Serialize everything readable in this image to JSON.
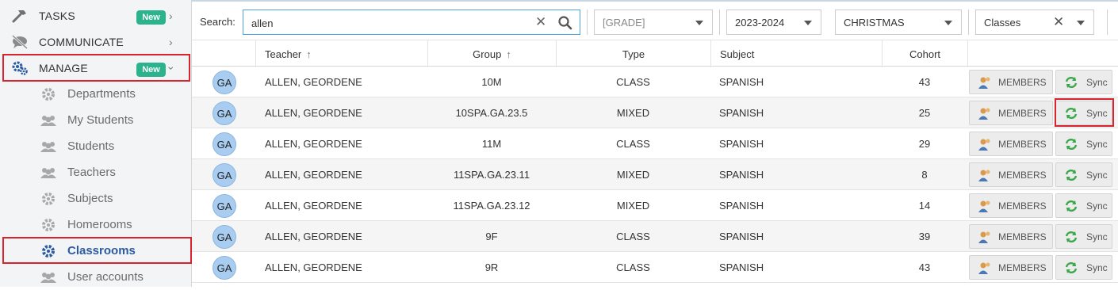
{
  "sidebar": {
    "top_items": [
      {
        "label": "TASKS",
        "badge": "New",
        "icon": "hammer-icon"
      },
      {
        "label": "COMMUNICATE",
        "icon": "chat-icon"
      },
      {
        "label": "MANAGE",
        "badge": "New",
        "icon": "gears-icon"
      }
    ],
    "sub_items": [
      {
        "label": "Departments",
        "icon": "gear-icon"
      },
      {
        "label": "My Students",
        "icon": "users-icon"
      },
      {
        "label": "Students",
        "icon": "users-icon"
      },
      {
        "label": "Teachers",
        "icon": "users-icon"
      },
      {
        "label": "Subjects",
        "icon": "gear-icon"
      },
      {
        "label": "Homerooms",
        "icon": "gear-icon"
      },
      {
        "label": "Classrooms",
        "icon": "gear-icon",
        "active": true
      },
      {
        "label": "User accounts",
        "icon": "users-icon"
      }
    ]
  },
  "filters": {
    "search_label": "Search:",
    "search_value": "allen",
    "grade": "[GRADE]",
    "year": "2023-2024",
    "term": "CHRISTMAS",
    "type": "Classes"
  },
  "table": {
    "headers": {
      "teacher": "Teacher",
      "group": "Group",
      "type": "Type",
      "subject": "Subject",
      "cohort": "Cohort"
    },
    "members_label": "MEMBERS",
    "sync_label": "Sync",
    "rows": [
      {
        "initials": "GA",
        "teacher": "ALLEN, GEORDENE",
        "group": "10M",
        "type": "CLASS",
        "subject": "SPANISH",
        "cohort": "43"
      },
      {
        "initials": "GA",
        "teacher": "ALLEN, GEORDENE",
        "group": "10SPA.GA.23.5",
        "type": "MIXED",
        "subject": "SPANISH",
        "cohort": "25"
      },
      {
        "initials": "GA",
        "teacher": "ALLEN, GEORDENE",
        "group": "11M",
        "type": "CLASS",
        "subject": "SPANISH",
        "cohort": "29"
      },
      {
        "initials": "GA",
        "teacher": "ALLEN, GEORDENE",
        "group": "11SPA.GA.23.11",
        "type": "MIXED",
        "subject": "SPANISH",
        "cohort": "8"
      },
      {
        "initials": "GA",
        "teacher": "ALLEN, GEORDENE",
        "group": "11SPA.GA.23.12",
        "type": "MIXED",
        "subject": "SPANISH",
        "cohort": "14"
      },
      {
        "initials": "GA",
        "teacher": "ALLEN, GEORDENE",
        "group": "9F",
        "type": "CLASS",
        "subject": "SPANISH",
        "cohort": "39"
      },
      {
        "initials": "GA",
        "teacher": "ALLEN, GEORDENE",
        "group": "9R",
        "type": "CLASS",
        "subject": "SPANISH",
        "cohort": "43"
      }
    ]
  },
  "colors": {
    "accent": "#2c5aa0",
    "badge": "#2bb38d",
    "highlight": "#d9232e",
    "avatar": "#a9cdf0",
    "sync_green": "#3aa84a"
  }
}
